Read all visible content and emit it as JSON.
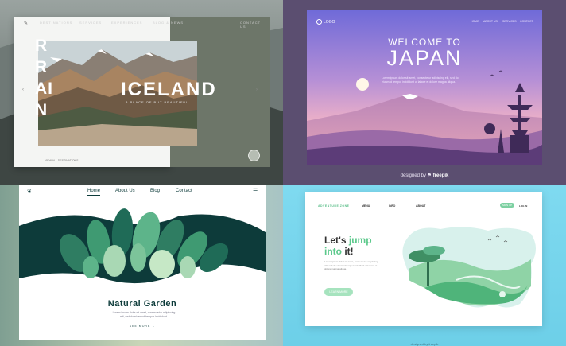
{
  "iceland": {
    "nav": [
      "DESTINATIONS",
      "SERVICES",
      "EXPERIENCES",
      "BLOG & NEWS",
      "CONTACT US"
    ],
    "big_letters": [
      "R",
      "R",
      "AI",
      "N"
    ],
    "title": "ICELAND",
    "subtitle": "A PLACE OF BUT BEAUTIFUL",
    "bottom_link": "VIEW ALL DESTINATIONS",
    "colors": {
      "card_right": "#6d7669",
      "card_left": "#f4f5f3"
    }
  },
  "japan": {
    "logo": "LOGO",
    "nav": [
      "HOME",
      "ABOUT US",
      "SERVICES",
      "CONTACT"
    ],
    "welcome": "WELCOME TO",
    "title": "JAPAN",
    "description": "Lorem ipsum dolor sit amet, consectetur adipiscing elit, sed do eiusmod tempor incididunt ut labore et dolore magna aliqua.",
    "footer_prefix": "designed by",
    "footer_brand": "freepik",
    "colors": {
      "sky_top": "#6f6ad8",
      "sky_bottom": "#f3b4c6",
      "frame_bg": "#5b4e70"
    }
  },
  "garden": {
    "nav": [
      "Home",
      "About Us",
      "Blog",
      "Contact"
    ],
    "title": "Natural Garden",
    "description": "Lorem ipsum dolor sit amet, consectetur adipiscing elit, sed do eiusmod tempor incididunt.",
    "see_more": "SEE MORE",
    "colors": {
      "dark_green": "#0d3b3a",
      "leaf": "#1f6b57"
    }
  },
  "jump": {
    "brand": "ADVENTURE ZONE",
    "nav": [
      "MENU",
      "INFO",
      "ABOUT"
    ],
    "signup": "SIGN UP",
    "login": "LOG IN",
    "heading_line1_plain": "Let's ",
    "heading_line1_green": "jump",
    "heading_line2_green": "into",
    "heading_line2_plain": " it!",
    "description": "Lorem ipsum dolor sit amet, consectetur adipiscing elit, sed do eiusmod tempor incididunt ut labore et dolore magna aliqua.",
    "cta": "LEARN MORE",
    "footer": "designed by freepik",
    "colors": {
      "green": "#5cc98c",
      "bg": "#7fdaf0"
    }
  }
}
